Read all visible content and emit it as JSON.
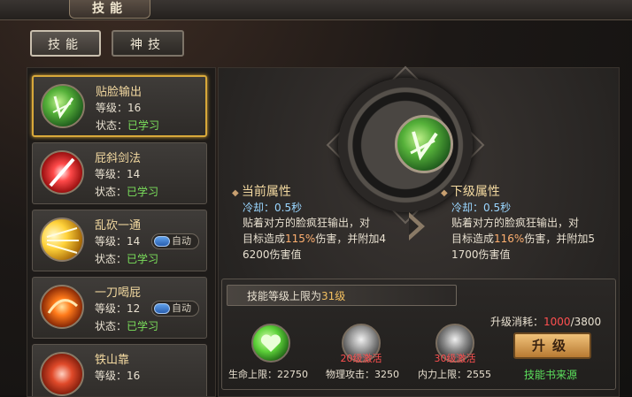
{
  "window": {
    "title": "技能"
  },
  "tabs": [
    {
      "label": "技能"
    },
    {
      "label": "神技"
    }
  ],
  "skills": [
    {
      "name": "贴脸输出",
      "level_label": "等级：",
      "level": "16",
      "status_label": "状态：",
      "status": "已学习",
      "auto": ""
    },
    {
      "name": "屁斜剑法",
      "level_label": "等级：",
      "level": "14",
      "status_label": "状态：",
      "status": "已学习",
      "auto": ""
    },
    {
      "name": "乱砍一通",
      "level_label": "等级：",
      "level": "14",
      "status_label": "状态：",
      "status": "已学习",
      "auto": "自动"
    },
    {
      "name": "一刀喝屁",
      "level_label": "等级：",
      "level": "12",
      "status_label": "状态：",
      "status": "已学习",
      "auto": "自动"
    },
    {
      "name": "铁山靠",
      "level_label": "等级：",
      "level": "16",
      "status_label": "",
      "status": "",
      "auto": ""
    }
  ],
  "current": {
    "title": "当前属性",
    "cooldown": "冷却：0.5秒",
    "desc1": "贴着对方的脸疯狂输出，对",
    "desc2_pre": "目标造成",
    "desc2_pct": "115%",
    "desc2_post": "伤害，并附加4",
    "desc3": "6200伤害值"
  },
  "next": {
    "title": "下级属性",
    "cooldown": "冷却：0.5秒",
    "desc1": "贴着对方的脸疯狂输出，对",
    "desc2_pre": "目标造成",
    "desc2_pct": "116%",
    "desc2_post": "伤害，并附加5",
    "desc3": "1700伤害值"
  },
  "limit": {
    "pre": "技能等级上限为",
    "value": "31级"
  },
  "upgrade": {
    "cost_label": "升级消耗：",
    "cost_have": "1000",
    "cost_sep": "/",
    "cost_need": "3800",
    "button": "升级",
    "book_link": "技能书来源"
  },
  "stats": [
    {
      "label": "生命上限：22750",
      "lock": ""
    },
    {
      "label": "物理攻击：3250",
      "lock": "20级激活"
    },
    {
      "label": "内力上限：2555",
      "lock": "30级激活"
    }
  ],
  "colors": {
    "accent_gold": "#d8a83a",
    "value_green": "#7be05c",
    "cost_red": "#ff5050",
    "cooldown_blue": "#9ad6ff"
  }
}
